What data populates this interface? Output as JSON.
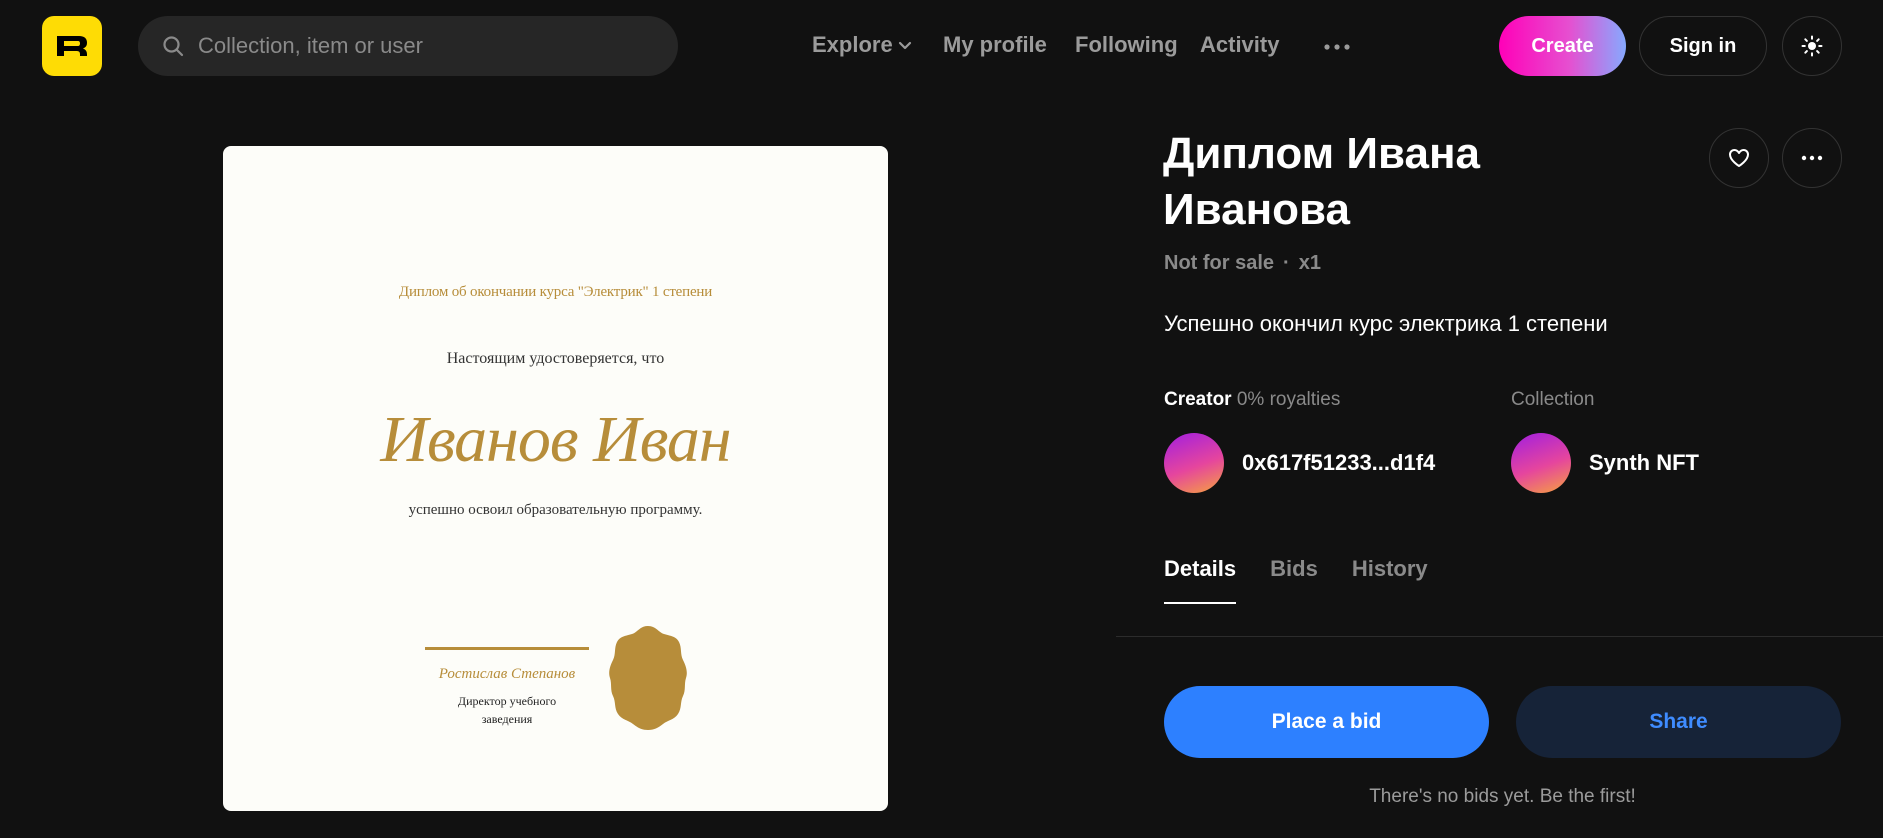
{
  "header": {
    "logo_icon": "rarible-logo-icon",
    "search": {
      "placeholder": "Collection, item or user",
      "value": ""
    },
    "nav": [
      {
        "label": "Explore",
        "has_dropdown": true
      },
      {
        "label": "My profile"
      },
      {
        "label": "Following"
      },
      {
        "label": "Activity"
      }
    ],
    "more_icon": "more-horizontal-icon",
    "create_label": "Create",
    "signin_label": "Sign in",
    "theme_icon": "sun-icon"
  },
  "artwork": {
    "line1": "Диплом об окончании курса \"Электрик\" 1 степени",
    "line2": "Настоящим удостоверяется, что",
    "name": "Иванов Иван",
    "line3": "успешно освоил образовательную программу.",
    "signature_name": "Ростислав Степанов",
    "signature_title_1": "Директор учебного",
    "signature_title_2": "заведения"
  },
  "item": {
    "title_line1": "Диплом Ивана",
    "title_line2": "Иванова",
    "status": "Not for sale",
    "separator": "·",
    "edition": "x1",
    "description": "Успешно окончил курс электрика 1 степени",
    "creator_label": "Creator",
    "royalties": "0% royalties",
    "creator_address": "0x617f51233...d1f4",
    "collection_label": "Collection",
    "collection_name": "Synth NFT"
  },
  "tabs": [
    {
      "label": "Details",
      "active": true
    },
    {
      "label": "Bids",
      "active": false
    },
    {
      "label": "History",
      "active": false
    }
  ],
  "actions": {
    "bid_label": "Place a bid",
    "share_label": "Share",
    "no_bids_text": "There's no bids yet. Be the first!"
  },
  "colors": {
    "background": "#111111",
    "logo_yellow": "#fedc05",
    "accent_blue": "#2d80ff",
    "gold": "#b78d3a"
  }
}
